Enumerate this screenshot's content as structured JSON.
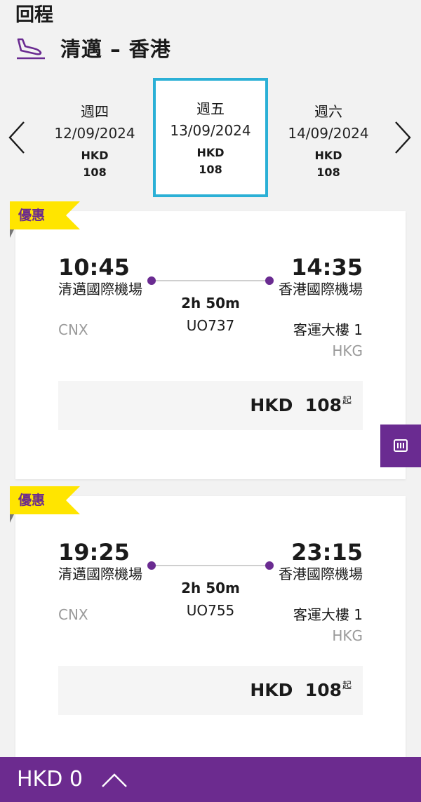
{
  "header": {
    "section_title": "回程",
    "route": "清邁 – 香港"
  },
  "dates": [
    {
      "weekday": "週四",
      "date": "12/09/2024",
      "currency": "HKD",
      "amount": "108"
    },
    {
      "weekday": "週五",
      "date": "13/09/2024",
      "currency": "HKD",
      "amount": "108",
      "selected": true
    },
    {
      "weekday": "週六",
      "date": "14/09/2024",
      "currency": "HKD",
      "amount": "108"
    }
  ],
  "flights": [
    {
      "badge": "優惠",
      "dep_time": "10:45",
      "dep_airport": "清邁國際機場",
      "dep_code": "CNX",
      "arr_time": "14:35",
      "arr_airport": "香港國際機場",
      "arr_terminal": "客運大樓 1",
      "arr_code": "HKG",
      "duration": "2h 50m",
      "flight_no": "UO737",
      "price_currency": "HKD",
      "price_amount": "108",
      "price_suffix": "起"
    },
    {
      "badge": "優惠",
      "dep_time": "19:25",
      "dep_airport": "清邁國際機場",
      "dep_code": "CNX",
      "arr_time": "23:15",
      "arr_airport": "香港國際機場",
      "arr_terminal": "客運大樓 1",
      "arr_code": "HKG",
      "duration": "2h 50m",
      "flight_no": "UO755",
      "price_currency": "HKD",
      "price_amount": "108",
      "price_suffix": "起"
    }
  ],
  "bottom_bar": {
    "total": "HKD 0"
  },
  "icons": {
    "route": "plane-landing-icon",
    "prev": "chevron-left-icon",
    "next": "chevron-right-icon",
    "side_tab": "barcode-icon",
    "bottom": "chevron-up-icon"
  },
  "colors": {
    "brand_purple": "#6c2b8f",
    "selected_border": "#2bb0d6",
    "promo_yellow": "#ffe500"
  }
}
